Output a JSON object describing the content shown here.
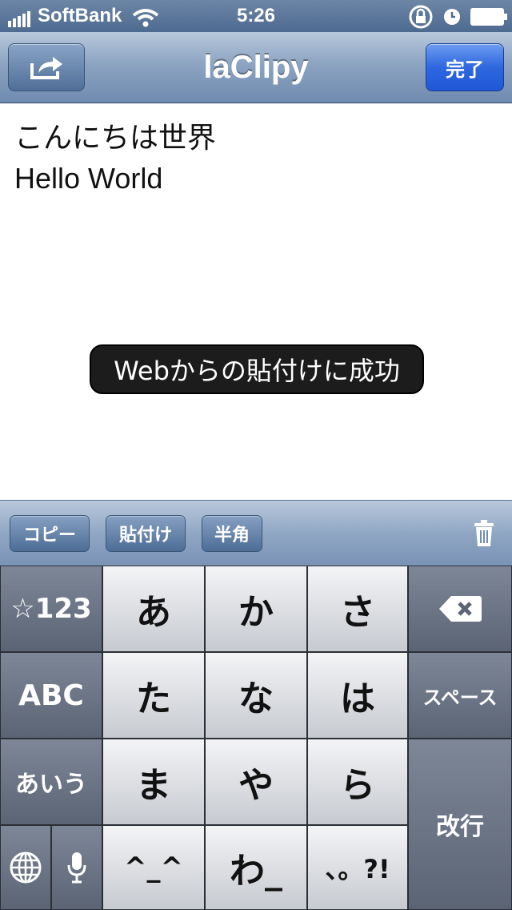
{
  "status": {
    "carrier": "SoftBank",
    "time": "5:26"
  },
  "nav": {
    "title": "laClipy",
    "done_label": "完了"
  },
  "content": {
    "lines": [
      "こんにちは世界",
      "Hello World"
    ]
  },
  "toast": {
    "message": "Webからの貼付けに成功"
  },
  "toolbar": {
    "copy_label": "コピー",
    "paste_label": "貼付け",
    "halfwidth_label": "半角"
  },
  "keyboard": {
    "symbols_label": "☆123",
    "abc_label": "ABC",
    "kana_label": "あいう",
    "key_a": "あ",
    "key_ka": "か",
    "key_sa": "さ",
    "key_ta": "た",
    "key_na": "な",
    "key_ha": "は",
    "key_ma": "ま",
    "key_ya": "や",
    "key_ra": "ら",
    "key_emoticon": "^_^",
    "key_wa": "わ_",
    "key_punct": "、。?!",
    "space_label": "スペース",
    "return_label": "改行"
  }
}
